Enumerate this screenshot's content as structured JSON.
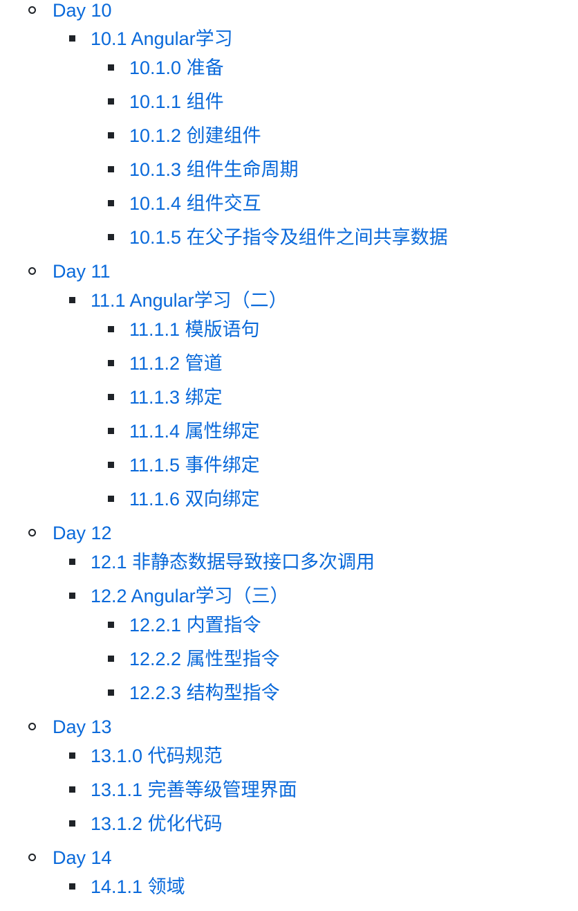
{
  "link_color": "#0969da",
  "bullet_color": "#1f2328",
  "items": [
    {
      "level": 1,
      "label": "Day 10"
    },
    {
      "level": 2,
      "label": "10.1 Angular学习"
    },
    {
      "level": 3,
      "label": "10.1.0 准备"
    },
    {
      "level": 3,
      "label": "10.1.1 组件"
    },
    {
      "level": 3,
      "label": "10.1.2 创建组件"
    },
    {
      "level": 3,
      "label": "10.1.3 组件生命周期"
    },
    {
      "level": 3,
      "label": "10.1.4 组件交互"
    },
    {
      "level": 3,
      "label": "10.1.5 在父子指令及组件之间共享数据"
    },
    {
      "level": 1,
      "label": "Day 11"
    },
    {
      "level": 2,
      "label": "11.1 Angular学习（二）"
    },
    {
      "level": 3,
      "label": "11.1.1 模版语句"
    },
    {
      "level": 3,
      "label": "11.1.2 管道"
    },
    {
      "level": 3,
      "label": "11.1.3 绑定"
    },
    {
      "level": 3,
      "label": "11.1.4 属性绑定"
    },
    {
      "level": 3,
      "label": "11.1.5 事件绑定"
    },
    {
      "level": 3,
      "label": "11.1.6 双向绑定"
    },
    {
      "level": 1,
      "label": "Day 12"
    },
    {
      "level": 2,
      "label": "12.1 非静态数据导致接口多次调用"
    },
    {
      "level": 2,
      "label": "12.2 Angular学习（三）"
    },
    {
      "level": 3,
      "label": "12.2.1 内置指令"
    },
    {
      "level": 3,
      "label": "12.2.2 属性型指令"
    },
    {
      "level": 3,
      "label": "12.2.3 结构型指令"
    },
    {
      "level": 1,
      "label": "Day 13"
    },
    {
      "level": 2,
      "label": "13.1.0 代码规范"
    },
    {
      "level": 2,
      "label": "13.1.1 完善等级管理界面"
    },
    {
      "level": 2,
      "label": "13.1.2 优化代码"
    },
    {
      "level": 1,
      "label": "Day 14"
    },
    {
      "level": 2,
      "label": "14.1.1 领域"
    }
  ]
}
